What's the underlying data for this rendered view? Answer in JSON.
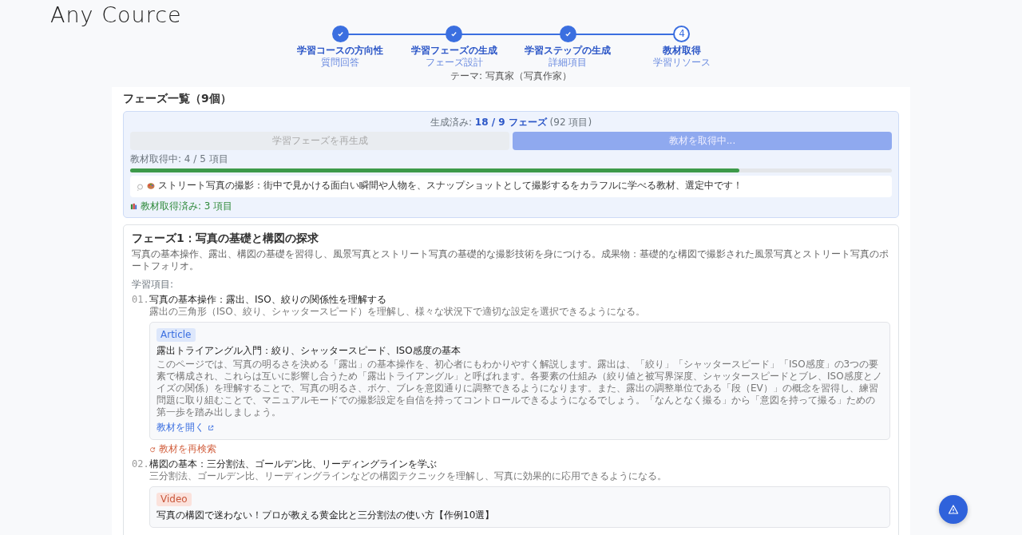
{
  "logo": "Any Cource",
  "steps": [
    {
      "label": "学習コースの方向性",
      "sub": "質問回答",
      "done": true
    },
    {
      "label": "学習フェーズの生成",
      "sub": "フェーズ設計",
      "done": true
    },
    {
      "label": "学習ステップの生成",
      "sub": "詳細項目",
      "done": true
    },
    {
      "label": "教材取得",
      "sub": "学習リソース",
      "done": false,
      "number": "4"
    }
  ],
  "theme": "テーマ: 写真家（写真作家）",
  "panel": {
    "title": "フェーズ一覧（9個）",
    "status": {
      "generated_label": "生成済み:",
      "generated_value": "18 / 9 フェーズ",
      "generated_count": "(92 項目)",
      "buttons": [
        {
          "label": "学習フェーズを再生成",
          "kind": "secondary",
          "disabled": true
        },
        {
          "label": "教材を取得中...",
          "kind": "primary",
          "disabled": true
        }
      ],
      "progress_label": "教材取得中: 4 / 5 項目",
      "level": 0.8,
      "message": "ストリート写真の撮影：街中で見かける面白い瞬間や人物を、スナップショットとして撮影するをカラフルに学べる教材、選定中です！",
      "fetched": "教材取得済み: 3 項目"
    },
    "phase": {
      "title": "フェーズ1：写真の基礎と構図の探求",
      "description": "写真の基本操作、露出、構図の基礎を習得し、風景写真とストリート写真の基礎的な撮影技術を身につける。成果物：基礎的な構図で撮影された風景写真とストリート写真のポートフォリオ。",
      "items_label": "学習項目:",
      "items": [
        {
          "number": "01.",
          "title": "写真の基本操作：露出、ISO、絞りの関係性を理解する",
          "description": "露出の三角形（ISO、絞り、シャッタースピード）を理解し、様々な状況下で適切な設定を選択できるようになる。",
          "material": {
            "kind": "article",
            "type": "Article",
            "title": "露出トライアングル入門：絞り、シャッタースピード、ISO感度の基本",
            "description": "このページでは、写真の明るさを決める「露出」の基本操作を、初心者にもわかりやすく解説します。露出は、「絞り」「シャッタースピード」「ISO感度」の3つの要素で構成され、これらは互いに影響し合うため「露出トライアングル」と呼ばれます。各要素の仕組み（絞り値と被写界深度、シャッタースピードとブレ、ISO感度とノイズの関係）を理解することで、写真の明るさ、ボケ、ブレを意図通りに調整できるようになります。また、露出の調整単位である「段（EV）」の概念を習得し、練習問題に取り組むことで、マニュアルモードでの撮影設定を自信を持ってコントロールできるようになるでしょう。「なんとなく撮る」から「意図を持って撮る」ための第一歩を踏み出しましょう。",
            "link": "教材を開く"
          },
          "research": "教材を再検索"
        },
        {
          "number": "02.",
          "title": "構図の基本：三分割法、ゴールデン比、リーディングラインを学ぶ",
          "description": "三分割法、ゴールデン比、リーディングラインなどの構図テクニックを理解し、写真に効果的に応用できるようになる。",
          "material": {
            "kind": "video",
            "type": "Video",
            "title": "写真の構図で迷わない！プロが教える黄金比と三分割法の使い方【作例10選】"
          }
        }
      ]
    }
  }
}
